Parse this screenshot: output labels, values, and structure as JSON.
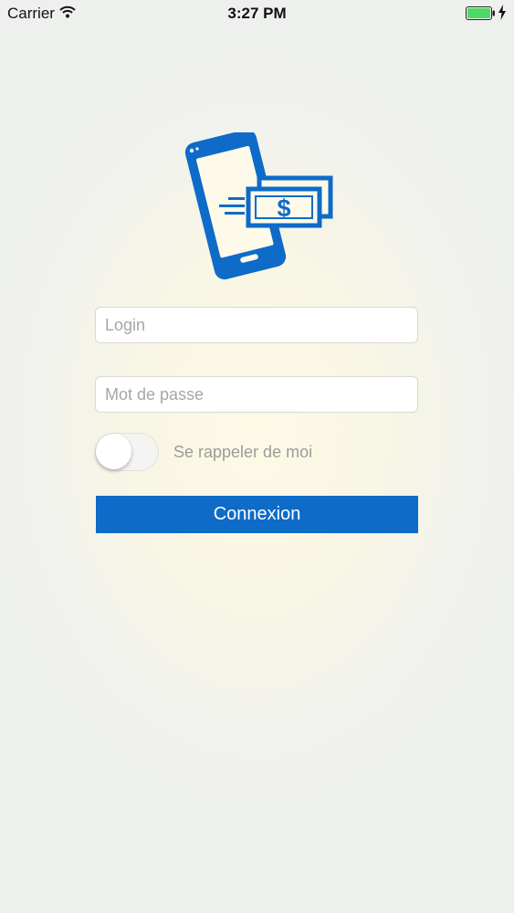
{
  "status_bar": {
    "carrier": "Carrier",
    "time": "3:27 PM",
    "icons": [
      "wifi-icon",
      "battery-icon",
      "charging-bolt-icon"
    ]
  },
  "logo": {
    "icon": "phone-money-transfer-icon",
    "color": "#0e6bc8"
  },
  "form": {
    "login_placeholder": "Login",
    "login_value": "",
    "password_placeholder": "Mot de passe",
    "password_value": "",
    "remember_label": "Se rappeler de moi",
    "remember_enabled": false,
    "submit_label": "Connexion"
  },
  "colors": {
    "accent": "#0e6bc8",
    "battery": "#4cd964",
    "label": "#9c9c9c"
  }
}
